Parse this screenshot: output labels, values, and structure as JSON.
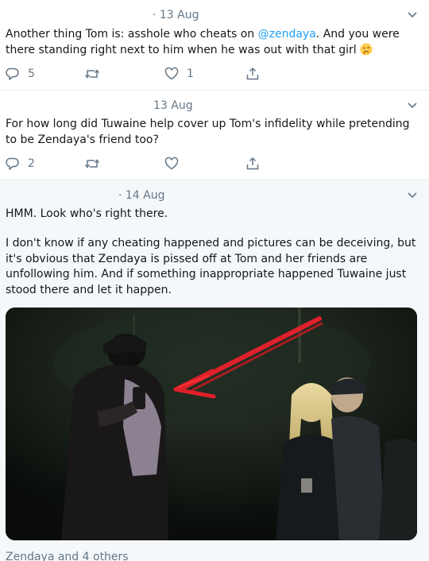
{
  "tweets": [
    {
      "date": "· 13 Aug",
      "text_before": "Another thing Tom is: asshole who cheats on ",
      "mention": "@zendaya",
      "text_after": ". And you were there standing right next to him when he was out with that girl",
      "emoji": "thinking-face",
      "replies": "5",
      "retweets": "",
      "likes": "1"
    },
    {
      "date": "13 Aug",
      "text": "For how long did Tuwaine help cover up Tom's infidelity while pretending to be Zendaya's friend too?",
      "replies": "2",
      "retweets": "",
      "likes": ""
    },
    {
      "date": "· 14 Aug",
      "text_line1": "HMM. Look who's right there.",
      "text_para2": "I don't know if any cheating happened and pictures can be deceiving, but it's obvious that Zendaya is pissed off at Tom and her friends are unfollowing him. And if something inappropriate happened Tuwaine just stood there and let it happen.",
      "photo_icon": "photo-with-red-arrow",
      "liked_by": "Zendaya and 4 others"
    }
  ],
  "colors": {
    "accent": "#1da1f2",
    "muted": "#657786",
    "text": "#14171a",
    "highlight_bg": "#f5f8fa",
    "arrow": "#e0202a"
  },
  "icons": [
    "reply-icon",
    "retweet-icon",
    "like-icon",
    "share-icon",
    "chevron-down-icon"
  ]
}
